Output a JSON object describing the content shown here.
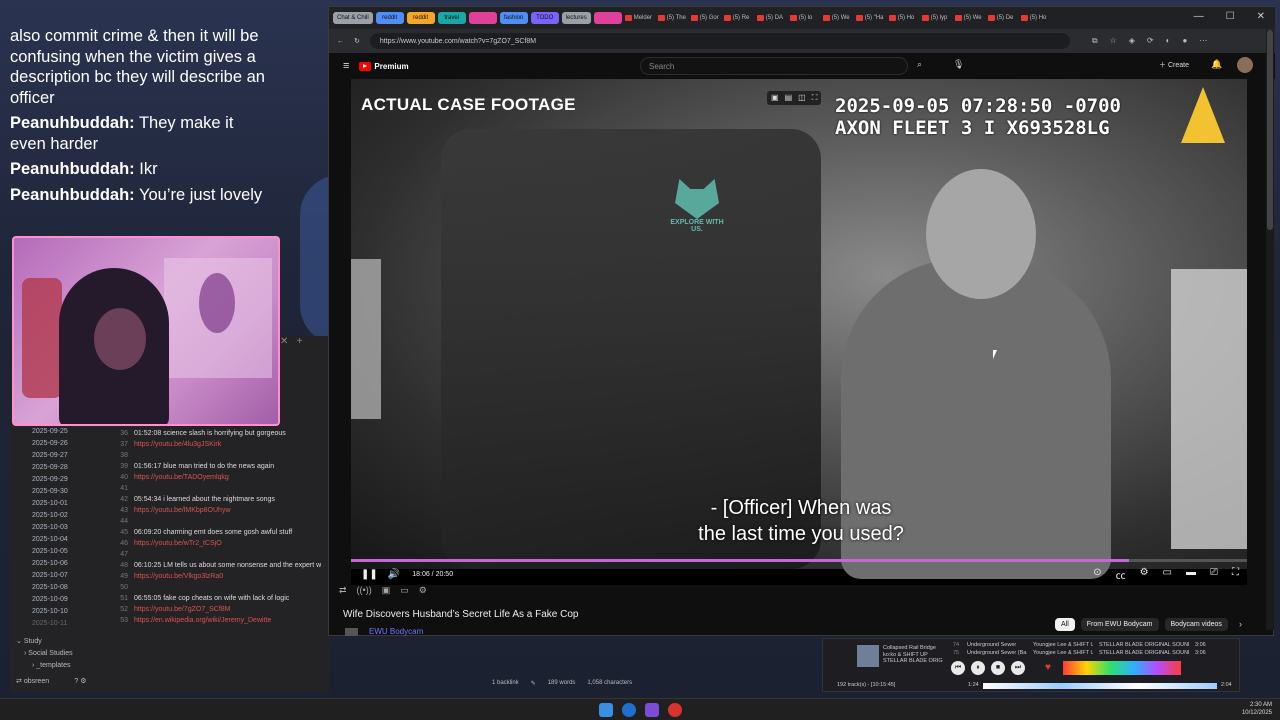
{
  "chat": {
    "messages": [
      {
        "user": "",
        "text": "also commit crime & then it will be confusing when the victim gives a description bc they will describe an officer"
      },
      {
        "user": "Peanuhbuddah:",
        "text": "They make it even harder"
      },
      {
        "user": "Peanuhbuddah:",
        "text": "Ikr"
      },
      {
        "user": "Peanuhbuddah:",
        "text": "You’re just lovely"
      }
    ]
  },
  "notes": {
    "dates": [
      "2025-09-25",
      "2025-09-26",
      "2025-09-27",
      "2025-09-28",
      "2025-09-29",
      "2025-09-30",
      "2025-10-01",
      "2025-10-02",
      "2025-10-03",
      "2025-10-04",
      "2025-10-05",
      "2025-10-06",
      "2025-10-07",
      "2025-10-08",
      "2025-10-09",
      "2025-10-10",
      "2025-10-11"
    ],
    "tree": [
      "Study",
      "Social Studies",
      "_templates"
    ],
    "vault": "obsreen",
    "lines": [
      {
        "num": "36",
        "text": "01:52:08 science slash is horrifying but gorgeous",
        "link": false
      },
      {
        "num": "37",
        "text": "https://youtu.be/4lu3gJSKirk",
        "link": true
      },
      {
        "num": "38",
        "text": "",
        "link": false
      },
      {
        "num": "39",
        "text": "01:56:17  blue man tried to do the news again",
        "link": false
      },
      {
        "num": "40",
        "text": "https://youtu.be/TADOyemlqkg",
        "link": true
      },
      {
        "num": "41",
        "text": "",
        "link": false
      },
      {
        "num": "42",
        "text": "05:54:34 i learned about the nightmare songs",
        "link": false
      },
      {
        "num": "43",
        "text": "https://youtu.be/lMKbp8OUhyw",
        "link": true
      },
      {
        "num": "44",
        "text": "",
        "link": false
      },
      {
        "num": "45",
        "text": "06:09:20  charming emt does some gosh awful stuff",
        "link": false
      },
      {
        "num": "46",
        "text": "https://youtu.be/wTr2_tCSjO",
        "link": true
      },
      {
        "num": "47",
        "text": "",
        "link": false
      },
      {
        "num": "48",
        "text": "06:10:25  LM tells us about some nonsense and the expert w",
        "link": false
      },
      {
        "num": "49",
        "text": "https://youtu.be/Vlkgo3lzRa0",
        "link": true
      },
      {
        "num": "50",
        "text": "",
        "link": false
      },
      {
        "num": "51",
        "text": "06:55:05 fake cop cheats on wife with lack of logic",
        "link": false
      },
      {
        "num": "52",
        "text": "https://youtu.be/7gZO7_SCf8M",
        "link": true
      },
      {
        "num": "53",
        "text": "https://en.wikipedia.org/wiki/Jeremy_Dewitte",
        "link": true
      }
    ],
    "status": {
      "backlinks": "1 backlink",
      "words": "189 words",
      "chars": "1,058 characters"
    }
  },
  "browser": {
    "tab_groups": [
      {
        "label": "Chat & Chill",
        "color": "#9aa0a6"
      },
      {
        "label": "reddit",
        "color": "#4f8ef7"
      },
      {
        "label": "reddit",
        "color": "#f5a623"
      },
      {
        "label": "travel",
        "color": "#1aa7a7"
      },
      {
        "label": "",
        "color": "#e0409a"
      },
      {
        "label": "fashion",
        "color": "#4f8ef7"
      },
      {
        "label": "TODO",
        "color": "#7b61ff"
      },
      {
        "label": "lectures",
        "color": "#9aa0a6"
      },
      {
        "label": "",
        "color": "#e0409a"
      }
    ],
    "tabs": [
      "Melder",
      "(5) The",
      "(5) Gor",
      "(5) Re",
      "(5) DA",
      "(5) lo",
      "(5) We",
      "(5) \"Ha",
      "(5) Ho",
      "(5) lyp",
      "(5) We",
      "(5) De",
      "(5) Ho"
    ],
    "url": "https://www.youtube.com/watch?v=7gZO7_SCf8M"
  },
  "youtube": {
    "brand": "Premium",
    "search_placeholder": "Search",
    "create_label": "Create",
    "overlay_label": "ACTUAL CASE FOOTAGE",
    "timestamp_line1": "2025-09-05 07:28:50 -0700",
    "timestamp_line2": "AXON FLEET 3 I X693528LG",
    "watermark": "EXPLORE WITH US.",
    "subtitle_line1": "- [Officer] When was",
    "subtitle_line2": "the last time you used?",
    "time_display": "18:06 / 20:50",
    "progress": 0.8688,
    "title": "Wife Discovers Husband’s Secret Life As a Fake Cop",
    "channel": "EWU Bodycam",
    "chips": [
      "All",
      "From EWU Bodycam",
      "Bodycam videos"
    ]
  },
  "music": {
    "now_playing": [
      "Collapsed Rail Bridge",
      "ko:ko & SHIFT UP",
      "STELLAR BLADE ORIG"
    ],
    "tracks": [
      {
        "n": "74",
        "title": "Underground Sewer",
        "artist": "Youngjee Lee & SHIFT UP",
        "album": "STELLAR BLADE ORIGINAL SOUND...",
        "len": "3:06"
      },
      {
        "n": "75",
        "title": "Underground Sewer (Ba...",
        "artist": "Youngjee Lee & SHIFT UP",
        "album": "STELLAR BLADE ORIGINAL SOUND...",
        "len": "3:06"
      }
    ],
    "footer": "192 track(s) - [10:15:45]",
    "elapsed": "1:24",
    "total": "2:04"
  },
  "clock": {
    "time": "2:30 AM",
    "date": "10/12/2025"
  }
}
